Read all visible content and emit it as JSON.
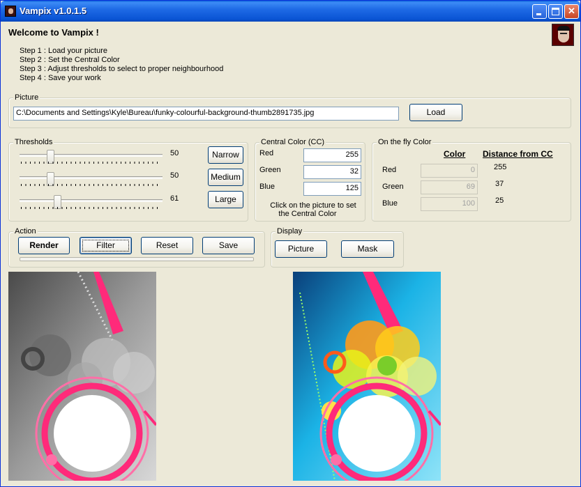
{
  "window": {
    "title": "Vampix v1.0.1.5"
  },
  "header": {
    "welcome": "Welcome to Vampix !",
    "steps": [
      "Step 1 : Load your picture",
      "Step 2 : Set the Central Color",
      "Step 3 : Adjust thresholds to select to proper neighbourhood",
      "Step 4 : Save your work"
    ]
  },
  "picture": {
    "label": "Picture",
    "path": "C:\\Documents and Settings\\Kyle\\Bureau\\funky-colourful-background-thumb2891735.jpg",
    "load_label": "Load"
  },
  "thresholds": {
    "label": "Thresholds",
    "sliders": [
      {
        "value": "50",
        "fraction": 0.2
      },
      {
        "value": "50",
        "fraction": 0.2
      },
      {
        "value": "61",
        "fraction": 0.25
      }
    ],
    "presets": [
      "Narrow",
      "Medium",
      "Large"
    ]
  },
  "central_color": {
    "label": "Central Color (CC)",
    "red_label": "Red",
    "red": "255",
    "green_label": "Green",
    "green": "32",
    "blue_label": "Blue",
    "blue": "125",
    "hint_line1": "Click on the picture to set",
    "hint_line2": "the Central Color"
  },
  "fly_color": {
    "label": "On the fly Color",
    "col_color": "Color",
    "col_distance": "Distance from CC",
    "red_label": "Red",
    "red": "0",
    "red_distance": "255",
    "green_label": "Green",
    "green": "69",
    "green_distance": "37",
    "blue_label": "Blue",
    "blue": "100",
    "blue_distance": "25"
  },
  "action": {
    "label": "Action",
    "render": "Render",
    "filter": "Filter",
    "reset": "Reset",
    "save": "Save",
    "progress": 0
  },
  "display": {
    "label": "Display",
    "picture": "Picture",
    "mask": "Mask"
  },
  "colors": {
    "title_blue": "#0a54d4",
    "window_bg": "#ece9d8",
    "accent_pink": "#ff2a7a",
    "sky_blue": "#1bb3e6"
  }
}
